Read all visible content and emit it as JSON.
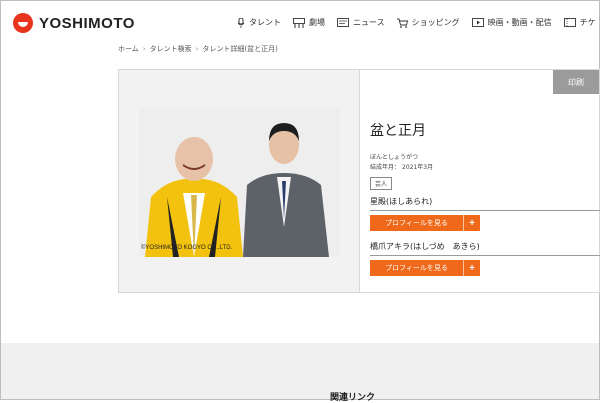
{
  "brand": {
    "name": "YOSHIMOTO",
    "color": "#e8341c"
  },
  "nav": [
    {
      "label": "タレント",
      "icon": "microphone-icon"
    },
    {
      "label": "劇場",
      "icon": "theater-icon"
    },
    {
      "label": "ニュース",
      "icon": "news-icon"
    },
    {
      "label": "ショッピング",
      "icon": "cart-icon"
    },
    {
      "label": "映画・動画・配信",
      "icon": "video-icon"
    },
    {
      "label": "チケ",
      "icon": "ticket-icon"
    }
  ],
  "breadcrumb": [
    "ホーム",
    "タレント検索",
    "タレント詳細(盆と正月)"
  ],
  "print_label": "印刷",
  "photo": {
    "copyright": "©YOSHIMOTO KOGYO CO.,LTD."
  },
  "talent": {
    "name": "盆と正月",
    "reading": "ぼんとしょうがつ",
    "formed_label": "結成年月：",
    "formed_value": "2021年3月",
    "category": "芸人",
    "members": [
      {
        "name": "星殿(ほしあられ)",
        "button": "プロフィールを見る"
      },
      {
        "name": "橋爪アキラ(はしづめ　あきら)",
        "button": "プロフィールを見る"
      }
    ]
  },
  "footer": {
    "related_label": "関連リンク"
  },
  "colors": {
    "accent": "#f0691a",
    "print_bg": "#9b9b9b"
  }
}
